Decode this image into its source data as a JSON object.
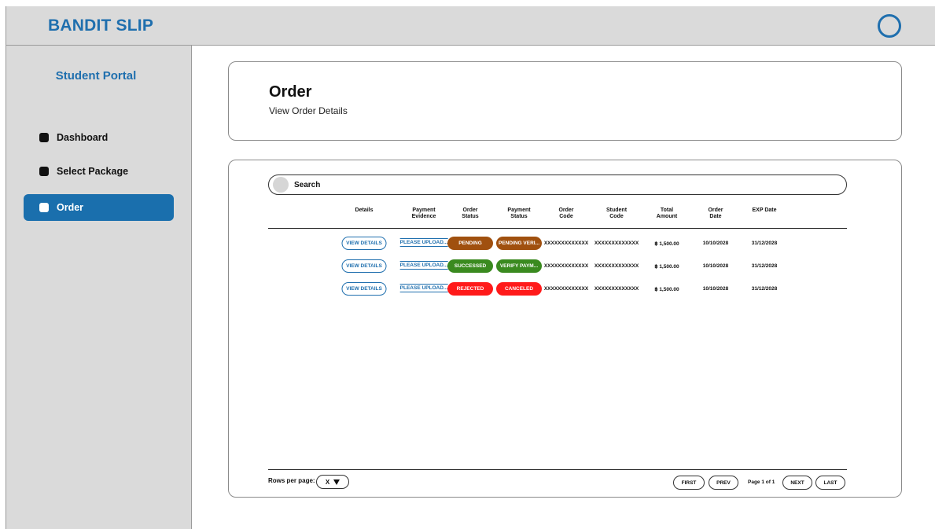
{
  "app": {
    "brand": "BANDIT SLIP"
  },
  "sidebar": {
    "title": "Student Portal",
    "items": [
      {
        "label": "Dashboard",
        "active": false
      },
      {
        "label": "Select Package",
        "active": false
      },
      {
        "label": "Order",
        "active": true
      }
    ]
  },
  "header": {
    "title": "Order",
    "subtitle": "View Order Details"
  },
  "search": {
    "label": "Search"
  },
  "table": {
    "columns": [
      [
        "Details",
        ""
      ],
      [
        "Payment",
        "Evidence"
      ],
      [
        "Order",
        "Status"
      ],
      [
        "Payment",
        "Status"
      ],
      [
        "Order",
        "Code"
      ],
      [
        "Student",
        "Code"
      ],
      [
        "Total",
        "Amount"
      ],
      [
        "Order",
        "Date"
      ],
      [
        "EXP Date",
        ""
      ]
    ],
    "rows": [
      {
        "details": "VIEW DETAILS",
        "evidence": "PLEASE UPLOAD...",
        "order_status": "PENDING",
        "order_status_color": "#a0500f",
        "payment_status": "PENDING VERI...",
        "payment_status_color": "#a0500f",
        "order_code": "XXXXXXXXXXXXX",
        "student_code": "XXXXXXXXXXXXX",
        "amount": "฿ 1,500.00",
        "order_date": "10/10/2028",
        "exp_date": "31/12/2028"
      },
      {
        "details": "VIEW DETAILS",
        "evidence": "PLEASE UPLOAD...",
        "order_status": "SUCCESSED",
        "order_status_color": "#3a8a1f",
        "payment_status": "VERIFY PAYM...",
        "payment_status_color": "#3a8a1f",
        "order_code": "XXXXXXXXXXXXX",
        "student_code": "XXXXXXXXXXXXX",
        "amount": "฿ 1,500.00",
        "order_date": "10/10/2028",
        "exp_date": "31/12/2028"
      },
      {
        "details": "VIEW DETAILS",
        "evidence": "PLEASE UPLOAD...",
        "order_status": "REJECTED",
        "order_status_color": "#ff1a1a",
        "payment_status": "CANCELED",
        "payment_status_color": "#ff1a1a",
        "order_code": "XXXXXXXXXXXXX",
        "student_code": "XXXXXXXXXXXXX",
        "amount": "฿ 1,500.00",
        "order_date": "10/10/2028",
        "exp_date": "31/12/2028"
      }
    ]
  },
  "pagination": {
    "rows_label": "Rows per page:",
    "rows_value": "X",
    "first": "FIRST",
    "prev": "PREV",
    "page_info": "Page 1 of 1",
    "next": "NEXT",
    "last": "LAST"
  },
  "colors": {
    "accent": "#1f6fae",
    "active_nav": "#1a6fad",
    "sidebar_bg": "#dadada"
  },
  "icons": {
    "profile": "profile-circle-icon",
    "search": "search-icon",
    "dropdown": "caret-down-icon",
    "nav": "square-bullet-icon"
  }
}
